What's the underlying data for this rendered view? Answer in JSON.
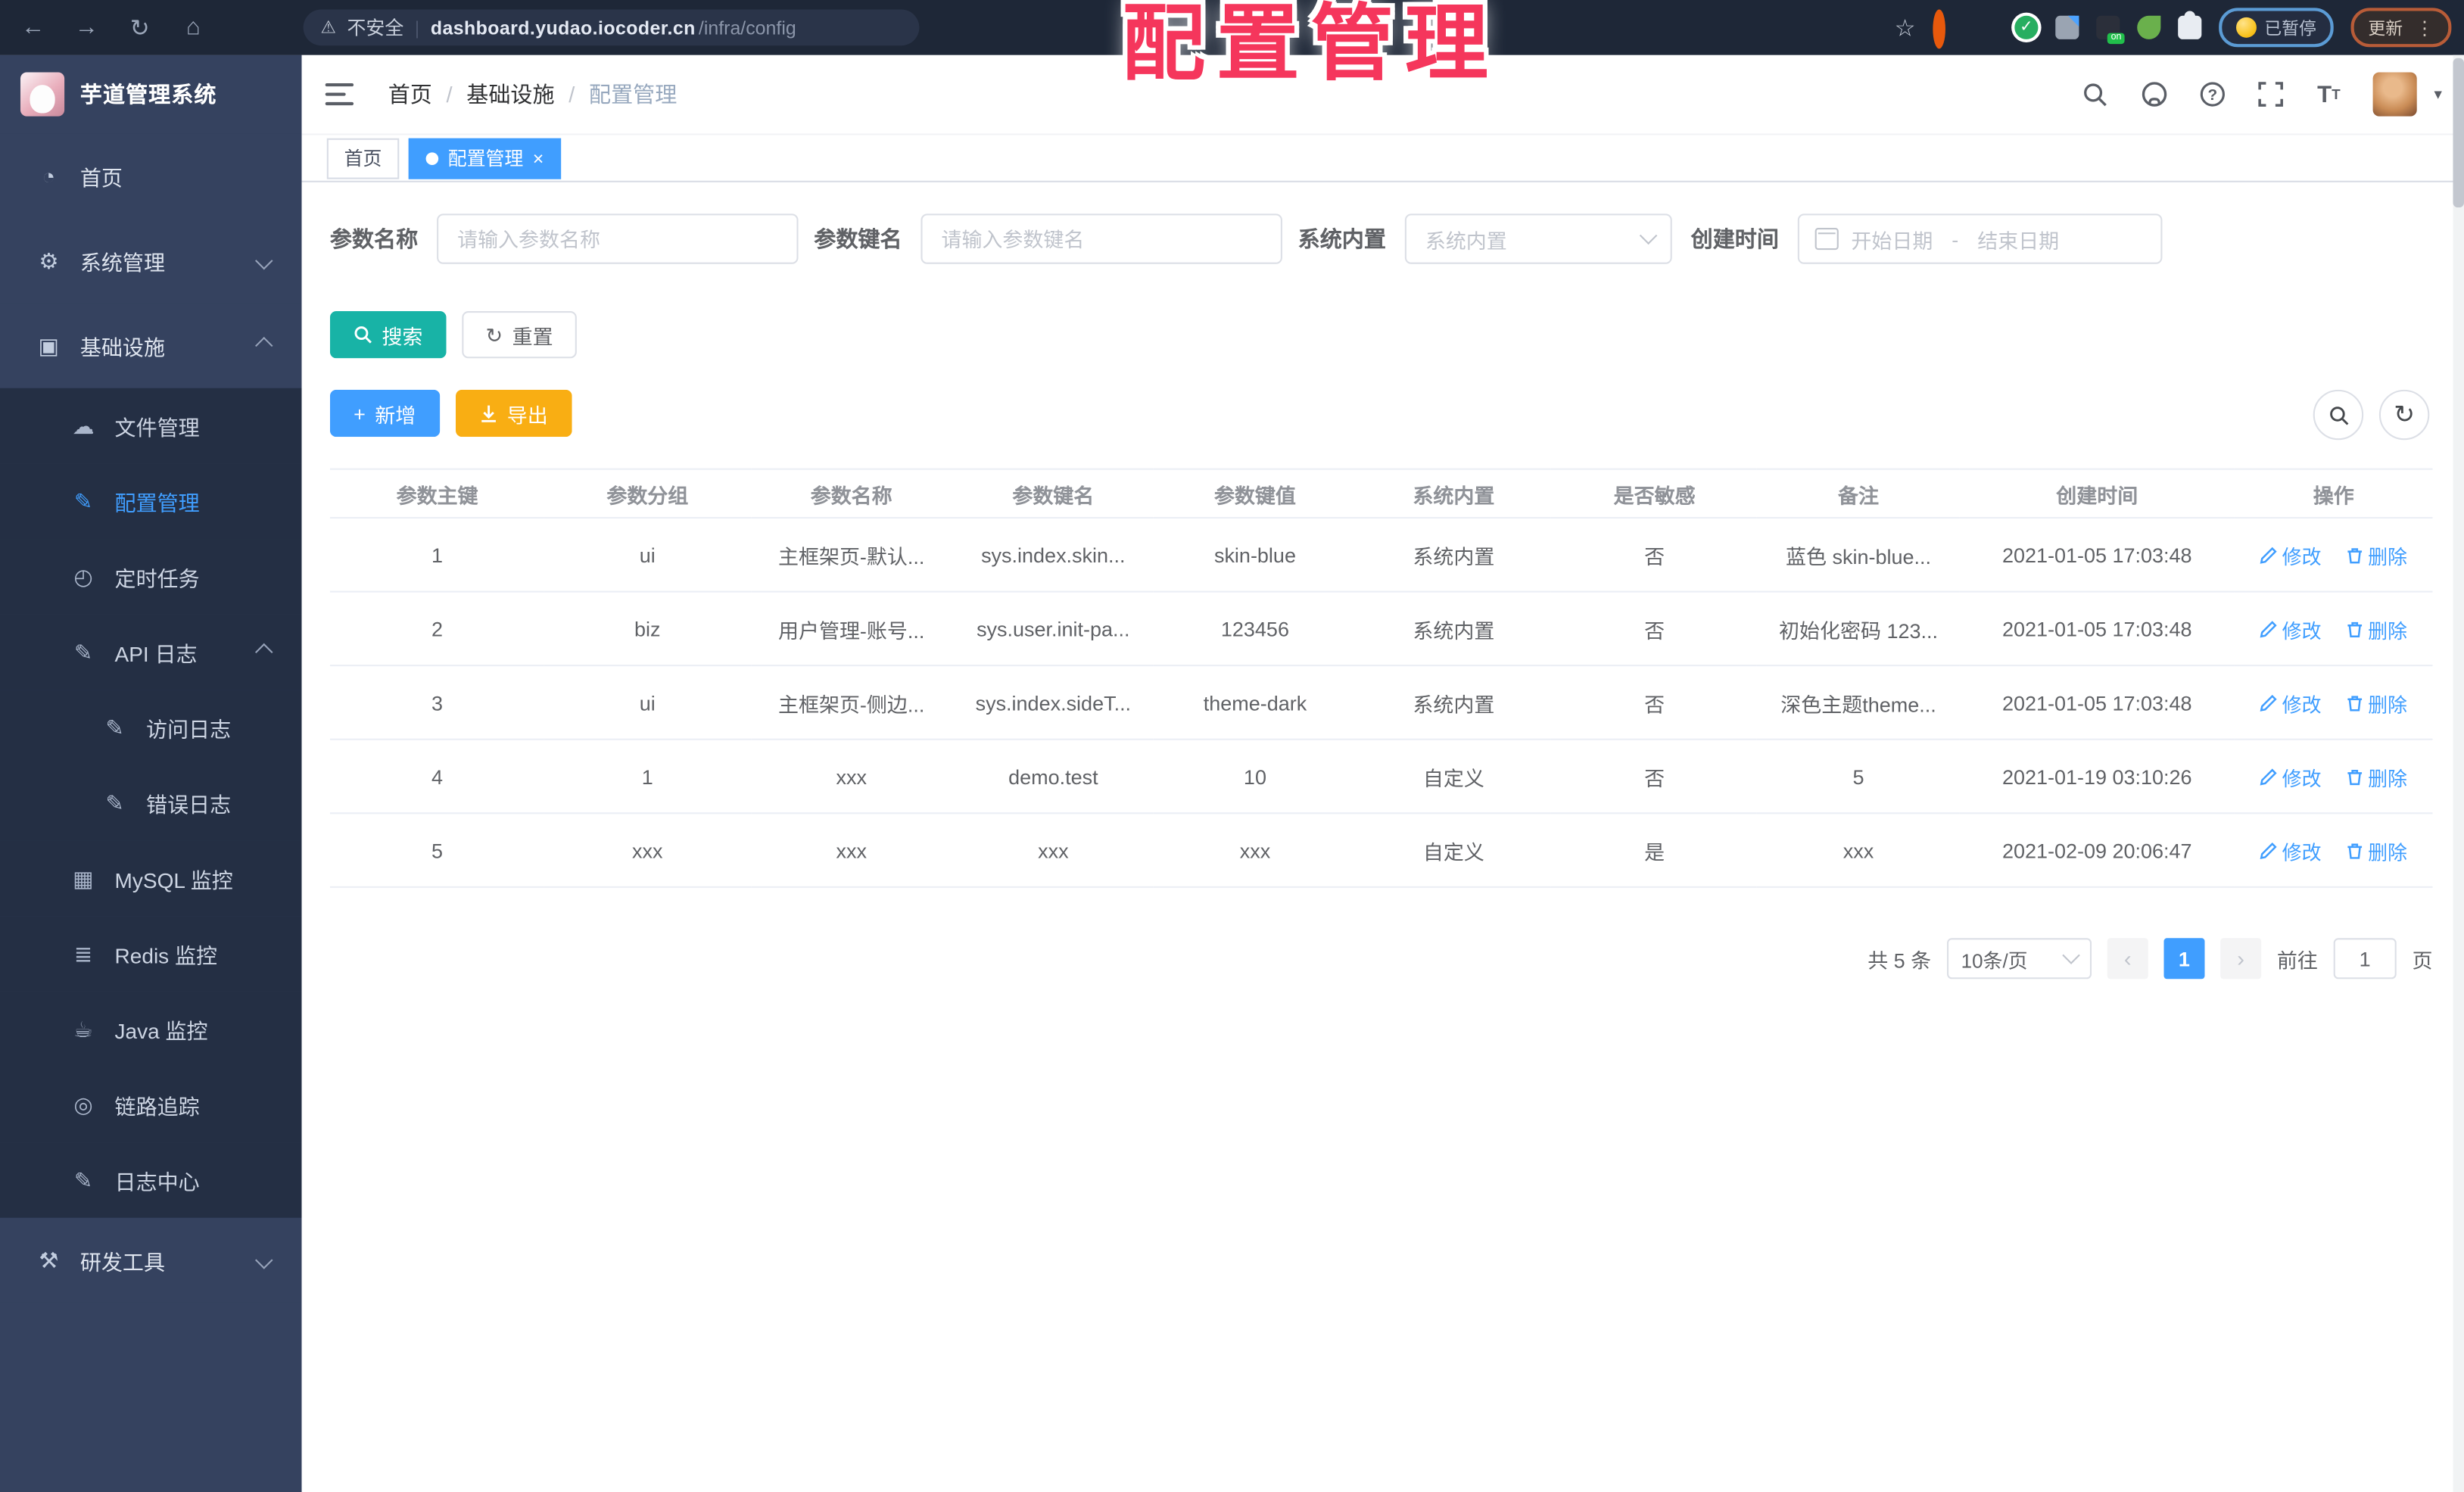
{
  "browser": {
    "nav_icons": [
      "back-arrow-icon",
      "forward-arrow-icon",
      "refresh-icon",
      "home-icon"
    ],
    "security_label": "不安全",
    "url_domain": "dashboard.yudao.iocoder.cn",
    "url_path": "/infra/config",
    "paused_badge_label": "已暂停",
    "update_button_label": "更新",
    "menu_dots": "⋮"
  },
  "overlay": {
    "title": "配置管理",
    "color": "#F5365C"
  },
  "header": {
    "logo_title": "芋道管理系统",
    "breadcrumb": {
      "items": [
        "首页",
        "基础设施",
        "配置管理"
      ],
      "separator": "/"
    },
    "action_icons": [
      "search-icon",
      "github-icon",
      "help-icon",
      "fullscreen-icon",
      "font-size-icon",
      "avatar",
      "chevron-down-icon"
    ]
  },
  "tabs": [
    {
      "label": "首页",
      "active": false
    },
    {
      "label": "配置管理",
      "active": true,
      "close": "×"
    }
  ],
  "sidebar": {
    "items": [
      {
        "id": "home",
        "label": "首页",
        "icon": "dashboard-icon",
        "level": 0
      },
      {
        "id": "system-management",
        "label": "系统管理",
        "icon": "gear-icon",
        "level": 0,
        "chevron": "down"
      },
      {
        "id": "infrastructure",
        "label": "基础设施",
        "icon": "monitor-icon",
        "level": 0,
        "chevron": "up"
      },
      {
        "id": "file-management",
        "label": "文件管理",
        "icon": "cloud-upload-icon",
        "level": 1
      },
      {
        "id": "config-management",
        "label": "配置管理",
        "icon": "edit-square-icon",
        "level": 1,
        "active": true
      },
      {
        "id": "scheduled-tasks",
        "label": "定时任务",
        "icon": "timer-icon",
        "level": 1
      },
      {
        "id": "api-log",
        "label": "API 日志",
        "icon": "log-edit-icon",
        "level": 1,
        "chevron": "up"
      },
      {
        "id": "access-log",
        "label": "访问日志",
        "icon": "log-edit-icon",
        "level": 2
      },
      {
        "id": "error-log",
        "label": "错误日志",
        "icon": "log-edit-icon",
        "level": 2
      },
      {
        "id": "mysql-monitor",
        "label": "MySQL 监控",
        "icon": "mysql-icon",
        "level": 1
      },
      {
        "id": "redis-monitor",
        "label": "Redis 监控",
        "icon": "redis-icon",
        "level": 1
      },
      {
        "id": "java-monitor",
        "label": "Java 监控",
        "icon": "java-icon",
        "level": 1
      },
      {
        "id": "trace",
        "label": "链路追踪",
        "icon": "eye-icon",
        "level": 1
      },
      {
        "id": "log-center",
        "label": "日志中心",
        "icon": "log-edit-icon",
        "level": 1
      },
      {
        "id": "dev-tools",
        "label": "研发工具",
        "icon": "toolbox-icon",
        "level": 0,
        "chevron": "down"
      }
    ]
  },
  "filter": {
    "fields": [
      {
        "label": "参数名称",
        "placeholder": "请输入参数名称",
        "type": "input"
      },
      {
        "label": "参数键名",
        "placeholder": "请输入参数键名",
        "type": "input"
      },
      {
        "label": "系统内置",
        "placeholder": "系统内置",
        "type": "select"
      },
      {
        "label": "创建时间",
        "start": "开始日期",
        "separator": "-",
        "end": "结束日期",
        "type": "daterange",
        "icon": "calendar-icon"
      }
    ],
    "search_label": "搜索",
    "reset_label": "重置"
  },
  "toolbar": {
    "add_label": "新增",
    "export_label": "导出",
    "corner_icons": [
      "search-toggle-icon",
      "refresh-icon"
    ]
  },
  "table": {
    "headers": [
      "参数主键",
      "参数分组",
      "参数名称",
      "参数键名",
      "参数键值",
      "系统内置",
      "是否敏感",
      "备注",
      "创建时间",
      "操作"
    ],
    "modify_label": "修改",
    "delete_label": "删除",
    "rows": [
      [
        "1",
        "ui",
        "主框架页-默认...",
        "sys.index.skin...",
        "skin-blue",
        "系统内置",
        "否",
        "蓝色 skin-blue...",
        "2021-01-05 17:03:48"
      ],
      [
        "2",
        "biz",
        "用户管理-账号...",
        "sys.user.init-pa...",
        "123456",
        "系统内置",
        "否",
        "初始化密码 123...",
        "2021-01-05 17:03:48"
      ],
      [
        "3",
        "ui",
        "主框架页-侧边...",
        "sys.index.sideT...",
        "theme-dark",
        "系统内置",
        "否",
        "深色主题theme...",
        "2021-01-05 17:03:48"
      ],
      [
        "4",
        "1",
        "xxx",
        "demo.test",
        "10",
        "自定义",
        "否",
        "5",
        "2021-01-19 03:10:26"
      ],
      [
        "5",
        "xxx",
        "xxx",
        "xxx",
        "xxx",
        "自定义",
        "是",
        "xxx",
        "2021-02-09 20:06:47"
      ]
    ]
  },
  "pagination": {
    "total": "共 5 条",
    "page_size": "10条/页",
    "prev": "‹",
    "current": "1",
    "next": "›",
    "goto_label": "前往",
    "goto_value": "1",
    "page_unit": "页"
  },
  "colors": {
    "primary": "#409EFF",
    "search_teal": "#18B3A6",
    "export_orange": "#F9AE13",
    "overlay_red": "#F5365C",
    "sidebar_bg": "#35425F",
    "submenu_bg": "#242F44",
    "browser_bar_bg": "#1E2737"
  }
}
